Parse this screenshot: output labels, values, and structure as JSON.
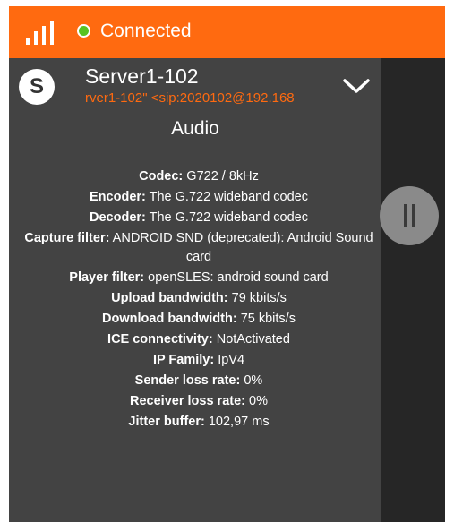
{
  "status_bar": {
    "connection_status": "Connected",
    "signal_icon": "signal-bars-icon",
    "status_dot_color": "#58c322",
    "background_color": "#ff6a10"
  },
  "call": {
    "avatar_letter": "S",
    "contact_name": "Server1-102",
    "contact_address": "rver1-102\" <sip:2020102@192.168",
    "collapse_icon": "chevron-down-icon",
    "accent_color": "#ff6a10"
  },
  "audio_stats": {
    "title": "Audio",
    "rows": [
      {
        "label": "Codec:",
        "value": "G722 / 8kHz"
      },
      {
        "label": "Encoder:",
        "value": "The G.722 wideband codec"
      },
      {
        "label": "Decoder:",
        "value": "The G.722 wideband codec"
      },
      {
        "label": "Capture filter:",
        "value": "ANDROID SND (deprecated): Android Sound card"
      },
      {
        "label": "Player filter:",
        "value": "openSLES: android sound card"
      },
      {
        "label": "Upload bandwidth:",
        "value": "79 kbits/s"
      },
      {
        "label": "Download bandwidth:",
        "value": "75 kbits/s"
      },
      {
        "label": "ICE connectivity:",
        "value": "NotActivated"
      },
      {
        "label": "IP Family:",
        "value": "IpV4"
      },
      {
        "label": "Sender loss rate:",
        "value": "0%"
      },
      {
        "label": "Receiver loss rate:",
        "value": "0%"
      },
      {
        "label": "Jitter buffer:",
        "value": "102,97 ms"
      }
    ]
  },
  "controls": {
    "pause_icon": "pause-icon"
  }
}
